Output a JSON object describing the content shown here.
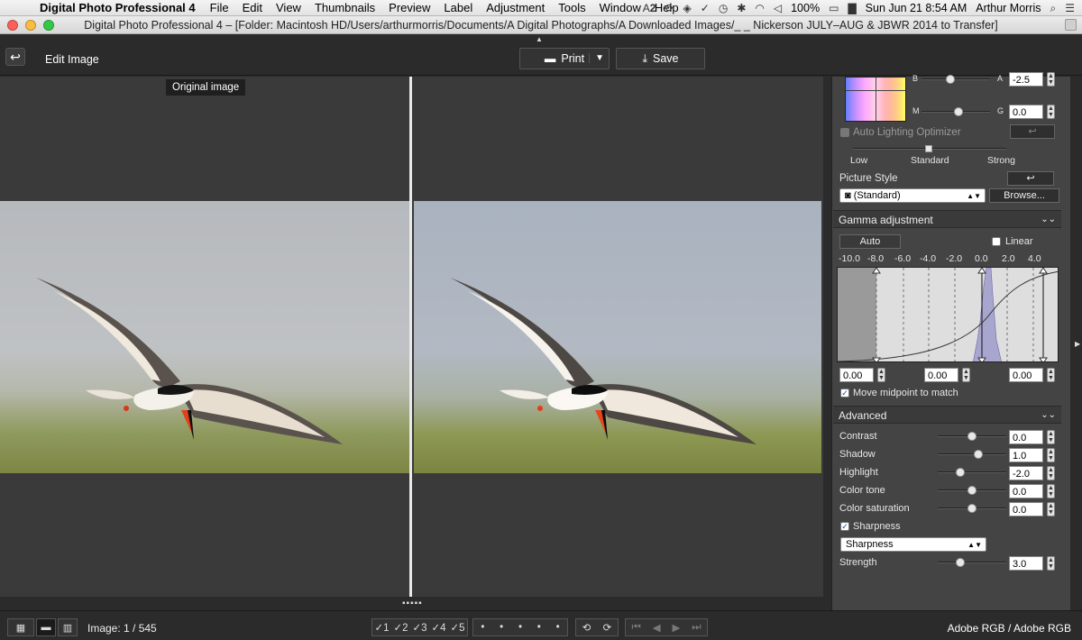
{
  "menubar": {
    "app_name": "Digital Photo Professional 4",
    "items": [
      "File",
      "Edit",
      "View",
      "Thumbnails",
      "Preview",
      "Label",
      "Adjustment",
      "Tools",
      "Window",
      "Help"
    ],
    "status_badge": "2",
    "battery": "100%",
    "clock": "Sun Jun 21  8:54 AM",
    "user": "Arthur Morris"
  },
  "window": {
    "title": "Digital Photo Professional 4 – [Folder: Macintosh HD/Users/arthurmorris/Documents/A Digital Photographs/A Downloaded Images/_ _ Nickerson JULY–AUG & JBWR 2014 to Transfer]"
  },
  "toolbar": {
    "back_icon": "back-arrow-icon",
    "title": "Edit Image",
    "print_label": "Print",
    "save_label": "Save"
  },
  "viewer": {
    "original_label": "Original image"
  },
  "panel": {
    "b_label": "B",
    "a_label": "A",
    "a_value": "-2.5",
    "m_label": "M",
    "g_label": "G",
    "g_value": "0.0",
    "auto_lighting_label": "Auto Lighting Optimizer",
    "alo_levels": [
      "Low",
      "Standard",
      "Strong"
    ],
    "picture_style_label": "Picture Style",
    "picture_style_value": "(Standard)",
    "browse_label": "Browse...",
    "gamma_title": "Gamma adjustment",
    "auto_label": "Auto",
    "linear_label": "Linear",
    "gamma_ticks": [
      "-10.0",
      "-8.0",
      "-6.0",
      "-4.0",
      "-2.0",
      "0.0",
      "2.0",
      "4.0"
    ],
    "gamma_values": [
      "0.00",
      "0.00",
      "0.00"
    ],
    "move_midpoint_label": "Move midpoint to match",
    "advanced_title": "Advanced",
    "advanced_rows": [
      {
        "label": "Contrast",
        "value": "0.0",
        "level": 0.5
      },
      {
        "label": "Shadow",
        "value": "1.0",
        "level": 0.6
      },
      {
        "label": "Highlight",
        "value": "-2.0",
        "level": 0.3
      },
      {
        "label": "Color tone",
        "value": "0.0",
        "level": 0.5
      },
      {
        "label": "Color saturation",
        "value": "0.0",
        "level": 0.5
      }
    ],
    "sharpness_check_label": "Sharpness",
    "sharpness_select": "Sharpness",
    "strength_label": "Strength",
    "strength_value": "3.0",
    "strength_level": 0.3
  },
  "statusbar": {
    "image_count": "Image: 1 / 545",
    "ratings": [
      "1",
      "2",
      "3",
      "4",
      "5"
    ],
    "colorspace": "Adobe RGB / Adobe RGB"
  }
}
